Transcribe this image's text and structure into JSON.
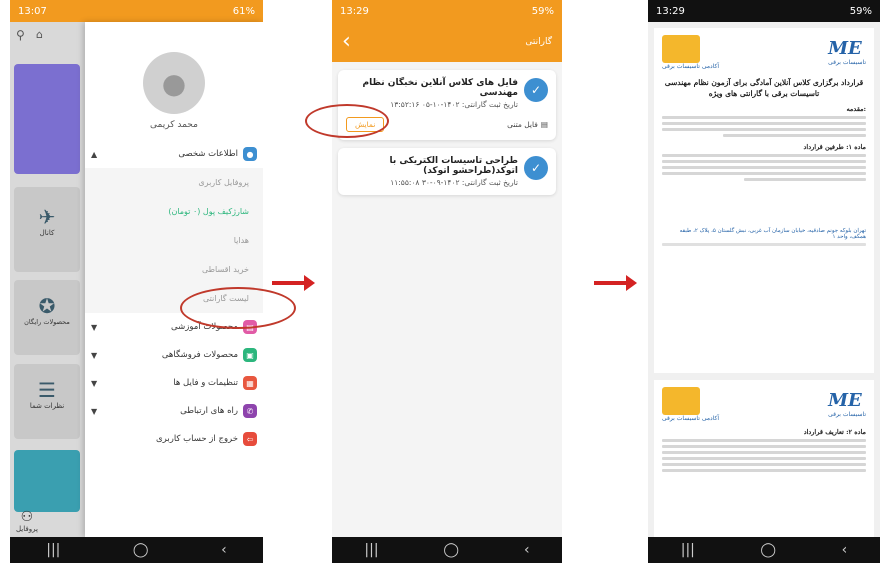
{
  "phone1": {
    "status_time": "13:07",
    "status_right": "61%",
    "user_name": "محمد کریمی",
    "menu": [
      {
        "label": "اطلاعات شخصی",
        "icon": "user-icon",
        "color": "#3d8fd1",
        "expanded": true
      },
      {
        "label": "محصولات آموزشی",
        "icon": "book-icon",
        "color": "#e15ba6"
      },
      {
        "label": "محصولات فروشگاهی",
        "icon": "shop-icon",
        "color": "#2cb67d"
      },
      {
        "label": "تنظیمات و فایل ها",
        "icon": "settings-icon",
        "color": "#e8573f"
      },
      {
        "label": "راه های ارتباطی",
        "icon": "phone-icon",
        "color": "#8e44ad"
      },
      {
        "label": "خروج از حساب کاربری",
        "icon": "logout-icon",
        "color": "#e74c3c"
      }
    ],
    "submenu": [
      {
        "label": "پروفایل کاربری"
      },
      {
        "label": "شارژکیف پول (۰ تومان)",
        "accent": "#2cb67d"
      },
      {
        "label": "هدایا"
      },
      {
        "label": "خرید اقساطی"
      },
      {
        "label": "لیست گارانتی"
      }
    ],
    "bg_labels": [
      "کانال",
      "محصولات رایگان",
      "نظرات شما",
      "پروفایل"
    ]
  },
  "phone2": {
    "status_time": "13:29",
    "status_right": "59%",
    "header_title": "گارانتی",
    "cards": [
      {
        "title": "فایل های کلاس آنلاین نخبگان نظام مهندسی",
        "date": "تاریخ ثبت گارانتی: ۱۴۰۲-۱۰-۰۵ ۱۳:۵۲:۱۶",
        "file_type": "فایل متنی",
        "button": "نمایش"
      },
      {
        "title": "طراحی تاسیسات الکتریکی با اتوکد(طراحشو اتوکد)",
        "date": "تاریخ ثبت گارانتی: ۱۴۰۲-۰۹-۳۰ ۱۱:۵۵:۰۸"
      }
    ]
  },
  "phone3": {
    "status_time": "13:29",
    "status_right": "59%",
    "logo_left_caption": "آکادمی تاسیسات برقی",
    "logo_right_caption": "تاسیسات برقی",
    "doc_title": "قرارداد برگزاری کلاس آنلاین آمادگی برای آزمون نظام مهندسی تاسیسات برقی با گارانتی های ویژه",
    "h1": "مقدمه:",
    "h2": "ماده ۱: طرفین قرارداد",
    "footer": "تهران بلوکه جونم صادقیه، خیابان سازمان آب غربی، نبش گلستان ۵، پلاک ۲، طبقه همکف، واحد ۱",
    "h3": "ماده ۲: تعاریف قرارداد"
  }
}
